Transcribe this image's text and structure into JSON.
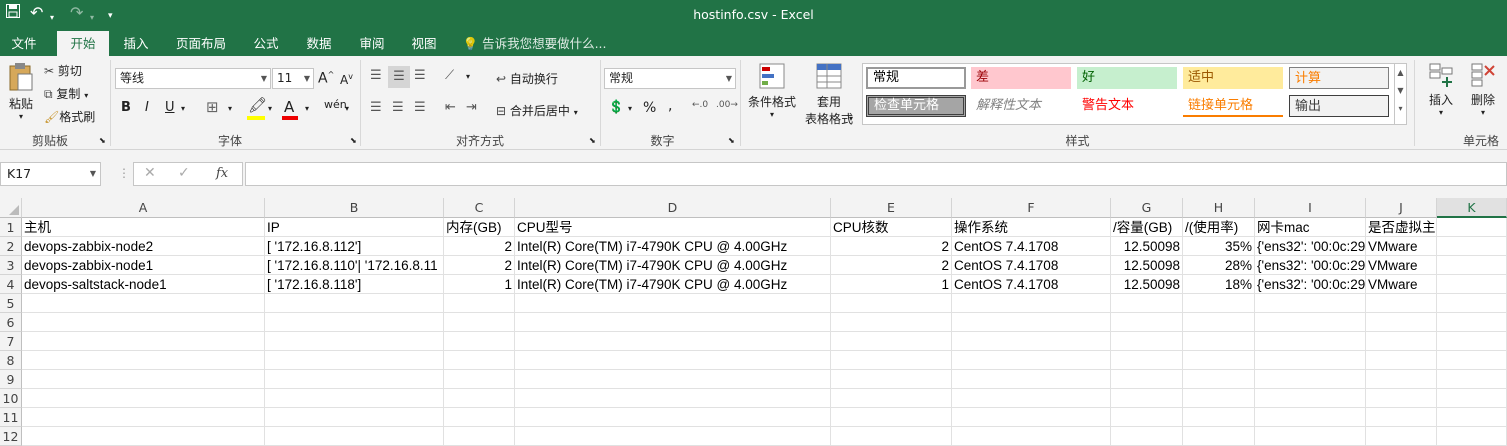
{
  "title": "hostinfo.csv - Excel",
  "qat": {
    "save": "save-icon",
    "undo": "undo-icon",
    "redo": "redo-icon"
  },
  "tabs": [
    "文件",
    "开始",
    "插入",
    "页面布局",
    "公式",
    "数据",
    "审阅",
    "视图"
  ],
  "tell_me": "告诉我您想要做什么...",
  "clipboard": {
    "paste": "粘贴",
    "cut": "剪切",
    "copy": "复制",
    "painter": "格式刷",
    "label": "剪贴板"
  },
  "font": {
    "name": "等线",
    "size": "11",
    "bold": "B",
    "italic": "I",
    "underline": "U",
    "wen": "wén",
    "label": "字体"
  },
  "align": {
    "wrap": "自动换行",
    "merge": "合并后居中",
    "label": "对齐方式"
  },
  "number": {
    "format": "常规",
    "percent": "%",
    "comma": ",",
    "label": "数字"
  },
  "styles": {
    "cond": "条件格式",
    "table1": "套用",
    "table2": "表格格式",
    "label": "样式",
    "cells": [
      "常规",
      "差",
      "好",
      "适中",
      "计算",
      "检查单元格",
      "解释性文本",
      "警告文本",
      "链接单元格",
      "输出"
    ]
  },
  "cells_group": {
    "insert": "插入",
    "delete": "删除",
    "label": "单元格"
  },
  "namebox": "K17",
  "fx": "fx",
  "columns": [
    "A",
    "B",
    "C",
    "D",
    "E",
    "F",
    "G",
    "H",
    "I",
    "J",
    "K"
  ],
  "row_numbers": [
    "1",
    "2",
    "3",
    "4",
    "5",
    "6",
    "7",
    "8",
    "9",
    "10",
    "11",
    "12"
  ],
  "rows": [
    [
      "主机",
      "IP",
      "内存(GB)",
      "CPU型号",
      "CPU核数",
      "操作系统",
      "/容量(GB)",
      "/(使用率)",
      "网卡mac",
      "是否虚拟主机",
      ""
    ],
    [
      "devops-zabbix-node2",
      "[ '172.16.8.112']",
      "2",
      "Intel(R) Core(TM) i7-4790K CPU @ 4.00GHz",
      "2",
      "CentOS 7.4.1708",
      "12.50098",
      "35%",
      "{'ens32': '00:0c:29",
      "VMware",
      ""
    ],
    [
      "devops-zabbix-node1",
      "[ '172.16.8.110'| '172.16.8.11",
      "2",
      "Intel(R) Core(TM) i7-4790K CPU @ 4.00GHz",
      "2",
      "CentOS 7.4.1708",
      "12.50098",
      "28%",
      "{'ens32': '00:0c:29",
      "VMware",
      ""
    ],
    [
      "devops-saltstack-node1",
      "[ '172.16.8.118']",
      "1",
      "Intel(R) Core(TM) i7-4790K CPU @ 4.00GHz",
      "1",
      "CentOS 7.4.1708",
      "12.50098",
      "18%",
      "{'ens32': '00:0c:29",
      "VMware",
      ""
    ]
  ],
  "colors": {
    "excel_green": "#217346"
  }
}
